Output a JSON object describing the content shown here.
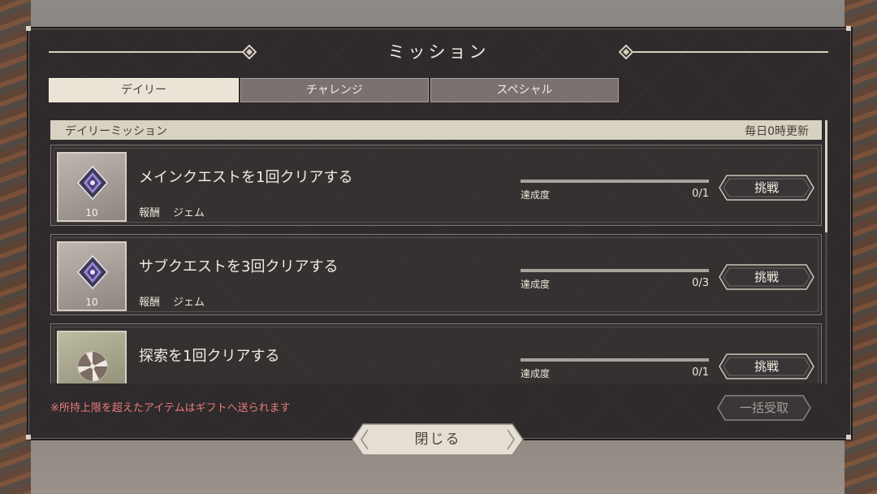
{
  "title": "ミッション",
  "tabs": [
    {
      "label": "デイリー",
      "active": true
    },
    {
      "label": "チャレンジ",
      "active": false
    },
    {
      "label": "スペシャル",
      "active": false
    }
  ],
  "section": {
    "label": "デイリーミッション",
    "reset": "毎日0時更新"
  },
  "missions": [
    {
      "title": "メインクエストを1回クリアする",
      "reward_label": "報酬",
      "reward_name": "ジェム",
      "reward_count": "10",
      "progress_label": "達成度",
      "progress_text": "0/1",
      "progress_fraction": 0,
      "button": "挑戦",
      "icon": "gem-icon"
    },
    {
      "title": "サブクエストを3回クリアする",
      "reward_label": "報酬",
      "reward_name": "ジェム",
      "reward_count": "10",
      "progress_label": "達成度",
      "progress_text": "0/3",
      "progress_fraction": 0,
      "button": "挑戦",
      "icon": "gem-icon"
    },
    {
      "title": "探索を1回クリアする",
      "progress_label": "達成度",
      "progress_text": "0/1",
      "progress_fraction": 0,
      "button": "挑戦",
      "icon": "pinwheel-candy-icon"
    }
  ],
  "note": "※所持上限を超えたアイテムはギフトへ送られます",
  "claim_all": "一括受取",
  "close": "閉じる",
  "colors": {
    "panel": "#2f2a2c",
    "accent_light": "#e9e4d6",
    "note_red": "#e77a7a"
  }
}
